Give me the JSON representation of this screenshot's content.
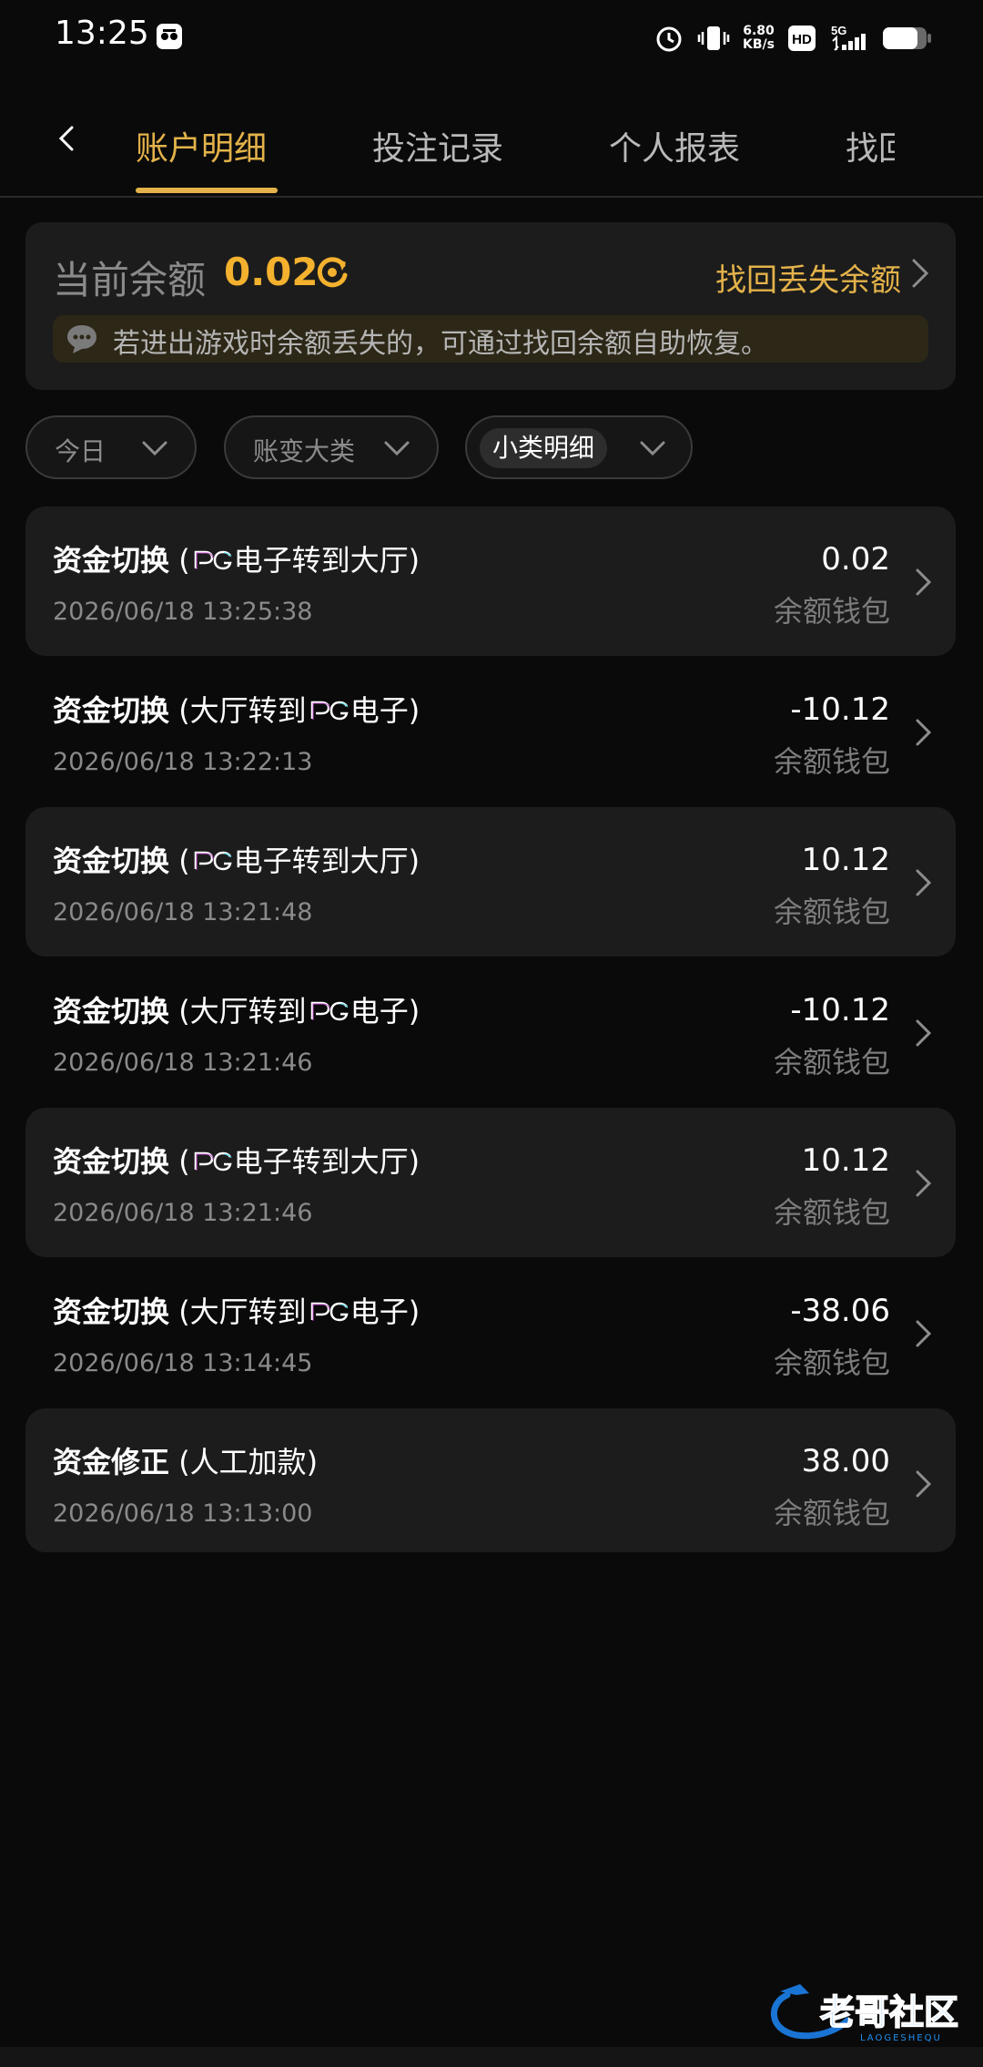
{
  "status_bar": {
    "time": "13:25",
    "speed_value": "6.80",
    "speed_unit": "KB/s",
    "hd": "HD",
    "net": "5G"
  },
  "tabs": [
    {
      "label": "账户明细",
      "active": true
    },
    {
      "label": "投注记录",
      "active": false
    },
    {
      "label": "个人报表",
      "active": false
    },
    {
      "label": "找回",
      "active": false
    }
  ],
  "balance": {
    "label": "当前余额",
    "value": "0.02",
    "recover_label": "找回丢失余额",
    "notice": "若进出游戏时余额丢失的，可通过找回余额自助恢复。"
  },
  "filters": [
    {
      "label": "今日"
    },
    {
      "label": "账变大类"
    },
    {
      "label": "小类明细"
    }
  ],
  "records": [
    {
      "category": "资金切换",
      "prefix": " (",
      "middle": "电子转到大厅)",
      "pg_first": true,
      "time": "2026/06/18 13:25:38",
      "amount": "0.02",
      "wallet": "余额钱包"
    },
    {
      "category": "资金切换",
      "prefix": " (大厅转到",
      "middle": "电子)",
      "pg_first": false,
      "time": "2026/06/18 13:22:13",
      "amount": "-10.12",
      "wallet": "余额钱包"
    },
    {
      "category": "资金切换",
      "prefix": " (",
      "middle": "电子转到大厅)",
      "pg_first": true,
      "time": "2026/06/18 13:21:48",
      "amount": "10.12",
      "wallet": "余额钱包"
    },
    {
      "category": "资金切换",
      "prefix": " (大厅转到",
      "middle": "电子)",
      "pg_first": false,
      "time": "2026/06/18 13:21:46",
      "amount": "-10.12",
      "wallet": "余额钱包"
    },
    {
      "category": "资金切换",
      "prefix": " (",
      "middle": "电子转到大厅)",
      "pg_first": true,
      "time": "2026/06/18 13:21:46",
      "amount": "10.12",
      "wallet": "余额钱包"
    },
    {
      "category": "资金切换",
      "prefix": " (大厅转到",
      "middle": "电子)",
      "pg_first": false,
      "time": "2026/06/18 13:14:45",
      "amount": "-38.06",
      "wallet": "余额钱包"
    },
    {
      "category": "资金修正",
      "prefix": " (人工加款)",
      "middle": "",
      "pg_first": null,
      "time": "2026/06/18 13:13:00",
      "amount": "38.00",
      "wallet": "余额钱包"
    }
  ],
  "colors": {
    "accent": "#e3b24a",
    "balance": "#f3b12e",
    "background": "#0a0a0a",
    "card": "#1c1c1c"
  },
  "watermark": {
    "text": "老哥社区",
    "sub": "LAOGESHEQU"
  }
}
